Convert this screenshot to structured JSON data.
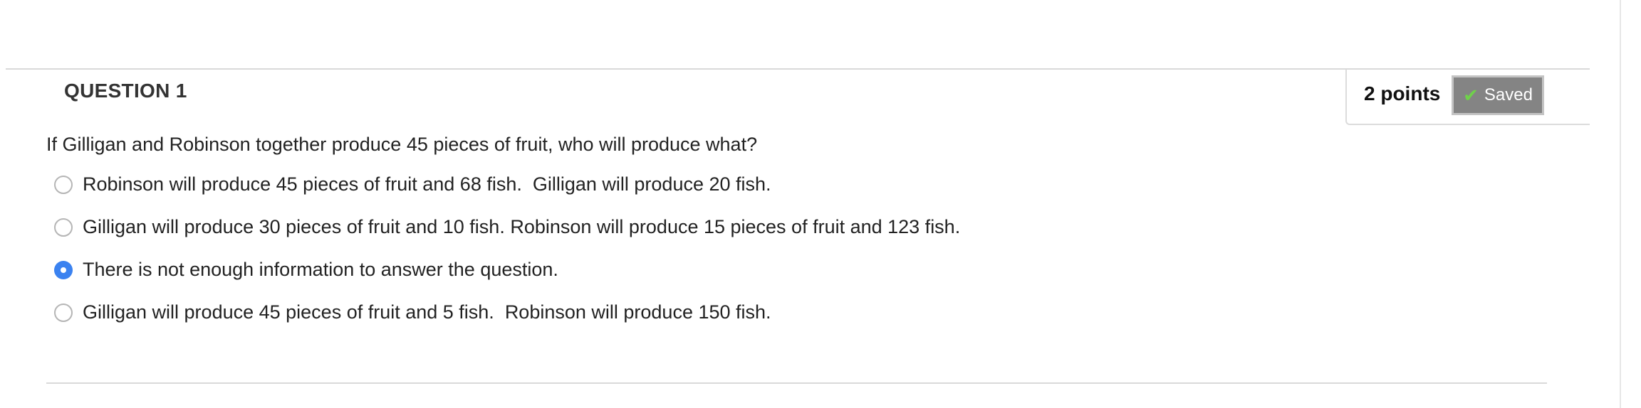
{
  "question": {
    "title": "QUESTION 1",
    "points": "2 points",
    "saved_label": "Saved",
    "saved_icon": "check-icon",
    "prompt": "If Gilligan and Robinson together produce 45 pieces of fruit, who will produce what?"
  },
  "options": [
    {
      "label": "Robinson will produce 45 pieces of fruit and 68 fish.  Gilligan will produce 20 fish.",
      "selected": false
    },
    {
      "label": "Gilligan will produce 30 pieces of fruit and 10 fish. Robinson will produce 15 pieces of fruit and 123 fish.",
      "selected": false
    },
    {
      "label": "There is not enough information to answer the question.",
      "selected": true
    },
    {
      "label": "Gilligan will produce 45 pieces of fruit and 5 fish.  Robinson will produce 150 fish.",
      "selected": false
    }
  ],
  "colors": {
    "radio_selected": "#3b82f0",
    "saved_button_bg": "#848484",
    "check_icon": "#6fd14a"
  }
}
